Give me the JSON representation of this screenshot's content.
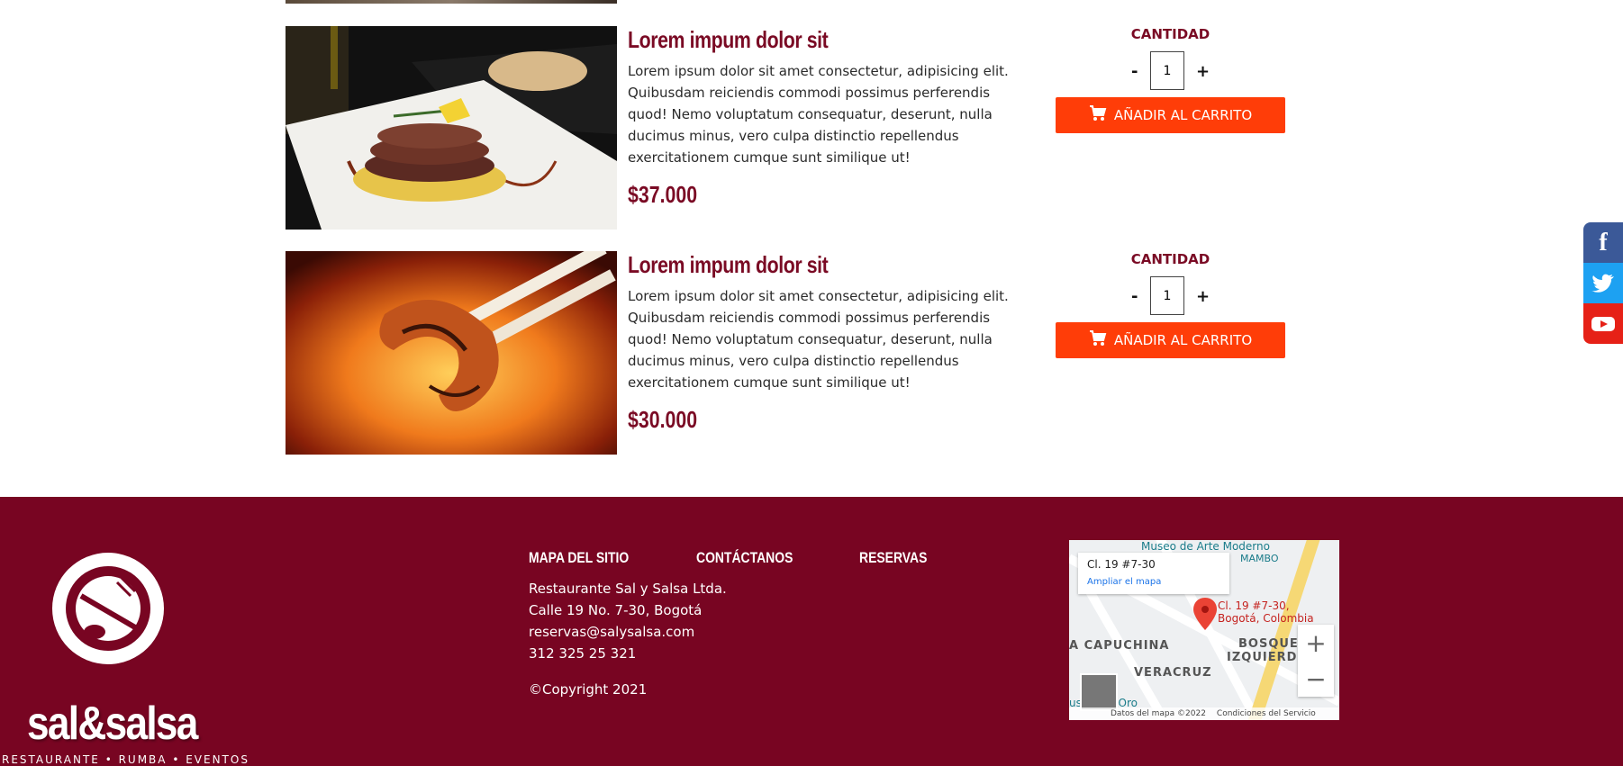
{
  "products": [
    {
      "title": "Lorem impum dolor sit",
      "description": "Lorem ipsum dolor sit amet consectetur, adipisicing elit. Quibusdam reiciendis commodi possimus perferendis quod! Nemo voluptatum consequatur, deserunt, nulla ducimus minus, vero culpa distinctio repellendus exercitationem cumque sunt similique ut!",
      "price": "$37.000",
      "quantity_label": "CANTIDAD",
      "quantity": "1",
      "minus": "-",
      "plus": "+",
      "add_label": "AÑADIR AL CARRITO"
    },
    {
      "title": "Lorem impum dolor sit",
      "description": "Lorem ipsum dolor sit amet consectetur, adipisicing elit. Quibusdam reiciendis commodi possimus perferendis quod! Nemo voluptatum consequatur, deserunt, nulla ducimus minus, vero culpa distinctio repellendus exercitationem cumque sunt similique ut!",
      "price": "$30.000",
      "quantity_label": "CANTIDAD",
      "quantity": "1",
      "minus": "-",
      "plus": "+",
      "add_label": "AÑADIR AL CARRITO"
    }
  ],
  "social": {
    "items": [
      "facebook-icon",
      "twitter-icon",
      "youtube-icon"
    ]
  },
  "footer": {
    "logo_word": "sal&salsa",
    "logo_tagline": "RESTAURANTE • RUMBA • EVENTOS",
    "nav": {
      "sitemap": "MAPA DEL SITIO",
      "contact": "CONTÁCTANOS",
      "reservations": "RESERVAS"
    },
    "contact_lines": [
      "Restaurante Sal y Salsa Ltda.",
      "Calle 19 No. 7-30, Bogotá",
      "reservas@salysalsa.com",
      "312 325 25 321"
    ],
    "copyright": "©Copyright 2021",
    "map": {
      "address": "Cl. 19 #7-30",
      "expand_link": "Ampliar el mapa",
      "pin_label_line1": "Cl. 19 #7-30,",
      "pin_label_line2": "Bogotá, Colombia",
      "area_top": "Museo de Arte Moderno",
      "area_mambo": "MAMBO",
      "area_capuchina": "A CAPUCHINA",
      "area_bosque": "BOSQUE",
      "area_izquierdo": "IZQUIERDO",
      "area_veracruz": "VERACRUZ",
      "area_museo_oro": "useo del Oro",
      "attribution_data": "Datos del mapa ©2022",
      "attribution_terms": "Condiciones del Servicio",
      "zoom_in": "+",
      "zoom_out": "−"
    },
    "bg_color": "#780522",
    "button_color": "#ff3d08",
    "title_color": "#7a0a24"
  }
}
